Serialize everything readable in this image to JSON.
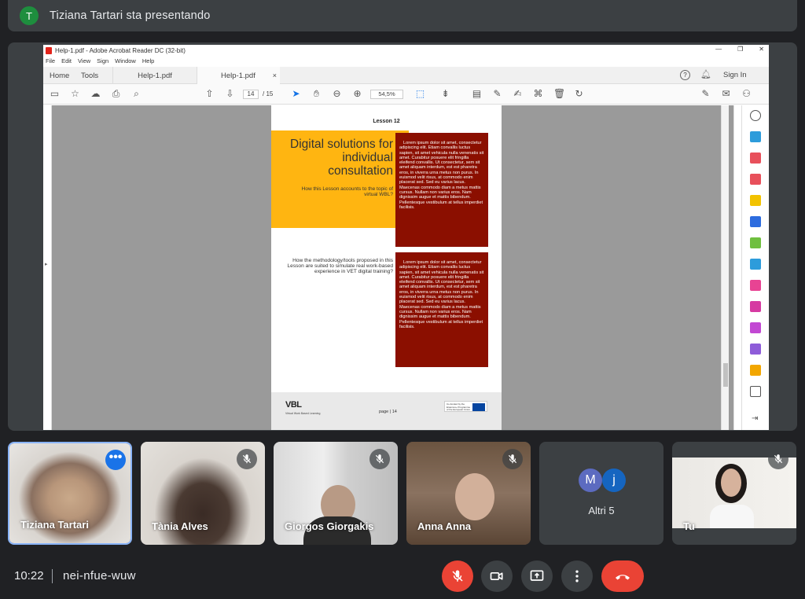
{
  "presenter": {
    "initial": "T",
    "text": "Tiziana Tartari sta presentando"
  },
  "acrobat": {
    "window_title": "Help-1.pdf - Adobe Acrobat Reader DC (32-bit)",
    "menu": [
      "File",
      "Edit",
      "View",
      "Sign",
      "Window",
      "Help"
    ],
    "tabs": {
      "home": "Home",
      "tools": "Tools",
      "doc1": "Help-1.pdf",
      "doc2": "Help-1.pdf",
      "close": "×"
    },
    "sign_in": "Sign In",
    "page_current": "14",
    "page_total": "/ 15",
    "zoom": "54,5%"
  },
  "pdf_page": {
    "lesson": "Lesson 12",
    "title": "Digital solutions for individual consultation",
    "subtitle": "How this Lesson accounts to the topic of virtual WBL?",
    "question2": "How the methodology/tools proposed in this Lesson are suited to simulate real work-based experience in VET digital training?",
    "lorem1": "Lorem ipsum dolor sit amet, consectetur adipiscing elit. Etiam convallis luctus sapien, sit amet vehicula nulla venenatis sit amet. Curabitur posuere elit fringilla eleifend convallis. Ut consectetur, sem sit amet aliquam interdum, est est pharetra eros, in viverra urna metus non purus. In euismod velit risus, at commodo enim placerat sed. Sed eu varius lacus. Maecenas commodo diam a metus mattis cursus. Nullam non varius eros. Nam dignissim augue et mattis bibendum. Pellentesque vestibulum at tellus imperdiet facilisis.",
    "lorem2": "Lorem ipsum dolor sit amet, consectetur adipiscing elit. Etiam convallis luctus sapien, sit amet vehicula nulla venenatis sit amet. Curabitur posuere elit fringilla eleifend convallis. Ut consectetur, sem sit amet aliquam interdum, est est pharetra eros, in viverra urna metus non purus. In euismod velit risus, at commodo enim placerat sed. Sed eu varius lacus. Maecenas commodo diam a metus mattis cursus. Nullam non varius eros. Nam dignissim augue et mattis bibendum. Pellentesque vestibulum at tellus imperdiet facilisis.",
    "logo": "VBL",
    "logo_sub": "Virtual Work Based Learning",
    "page_label": "page | 14",
    "eu_text": "Co-funded by the Erasmus+ Programme of the European Union"
  },
  "participants": [
    {
      "name": "Tiziana Tartari",
      "muted": false
    },
    {
      "name": "Tània Alves",
      "muted": true
    },
    {
      "name": "Giorgos Giorgakis",
      "muted": true
    },
    {
      "name": "Anna Anna",
      "muted": true
    },
    {
      "name": "Altri 5",
      "avatars": [
        "M",
        "j"
      ]
    },
    {
      "name": "Tu",
      "muted": true
    }
  ],
  "meeting": {
    "time": "10:22",
    "code": "nei-nfue-wuw"
  },
  "colors": {
    "accent": "#1a73e8",
    "danger": "#ea4335",
    "surface": "#3c4043",
    "background": "#202124",
    "pdf_yellow": "#ffb511",
    "pdf_red": "#8b0f00"
  }
}
